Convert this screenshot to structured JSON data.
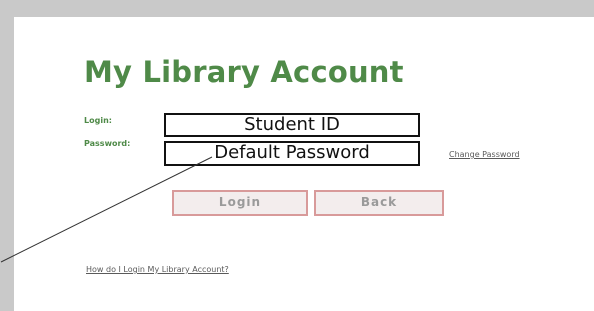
{
  "page": {
    "title": "My Library Account"
  },
  "form": {
    "login_label": "Login:",
    "password_label": "Password:",
    "login_value": "Student ID",
    "password_value": "Default Password",
    "change_password_link": "Change Password",
    "login_button": "Login",
    "back_button": "Back"
  },
  "help": {
    "link": "How do I Login My Library Account?"
  },
  "colors": {
    "title_green": "#4f8a48",
    "frame_gray": "#c9c9c9",
    "button_border": "#d89a9a"
  }
}
